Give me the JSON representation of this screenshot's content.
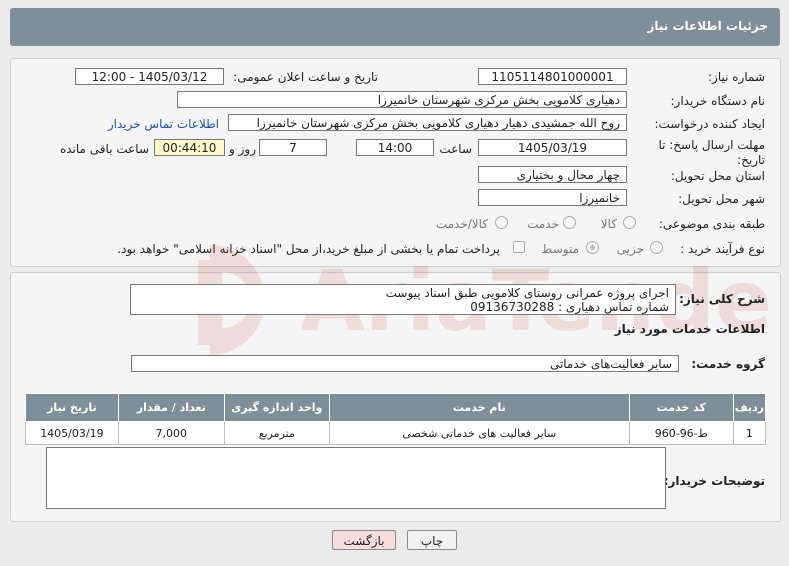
{
  "header": {
    "title": "جزئیات اطلاعات نیاز"
  },
  "need_number": {
    "label": "شماره نیاز:",
    "value": "1105114801000001"
  },
  "announce": {
    "label": "تاریخ و ساعت اعلان عمومی:",
    "value": "1405/03/12 - 12:00"
  },
  "buyer_org": {
    "label": "نام دستگاه خریدار:",
    "value": "دهیاری کلامویی بخش مرکزی شهرستان خانمیرزا"
  },
  "creator": {
    "label": "ایجاد کننده درخواست:",
    "value": "روح الله جمشیدی دهیار دهیاری کلامویی بخش مرکزی شهرستان خانمیرزا",
    "contact_link": "اطلاعات تماس خریدار"
  },
  "deadline": {
    "label": "مهلت ارسال پاسخ: تا تاریخ:",
    "date": "1405/03/19",
    "time_label": "ساعت",
    "time": "14:00",
    "days": "7",
    "days_label": "روز و",
    "remaining": "00:44:10",
    "remaining_label": "ساعت باقی مانده"
  },
  "province": {
    "label": "استان محل تحویل:",
    "value": "چهار محال و بختیاری"
  },
  "city": {
    "label": "شهر محل تحویل:",
    "value": "خانمیرزا"
  },
  "category": {
    "label": "طبقه بندی موضوعی:",
    "options": [
      "کالا",
      "خدمت",
      "کالا/خدمت"
    ]
  },
  "process": {
    "label": "نوع فرآیند خرید :",
    "options": [
      "جزیی",
      "متوسط"
    ],
    "note": "پرداخت تمام یا بخشی از مبلغ خرید،از محل \"اسناد خزانه اسلامی\" خواهد بود."
  },
  "description": {
    "label": "شرح کلی نیاز:",
    "line1": "اجرای پروژه عمرانی روستای کلامویی طبق اسناد پیوست",
    "line2": "شماره تماس دهیاری : 09136730288"
  },
  "services_title": "اطلاعات خدمات مورد نیاز",
  "service_group": {
    "label": "گروه خدمت:",
    "value": "سایر فعالیت‌های خدماتی"
  },
  "table": {
    "headers": [
      "ردیف",
      "کد خدمت",
      "نام خدمت",
      "واحد اندازه گیری",
      "تعداد / مقدار",
      "تاریخ نیاز"
    ],
    "rows": [
      [
        "1",
        "ط-96-960",
        "سایر فعالیت های خدماتی شخصی",
        "مترمربع",
        "7,000",
        "1405/03/19"
      ]
    ]
  },
  "buyer_notes": {
    "label": "توضیحات خریدار:",
    "value": ""
  },
  "buttons": {
    "print": "چاپ",
    "back": "بازگشت"
  },
  "watermark": {
    "text": "AriaTender.net"
  }
}
